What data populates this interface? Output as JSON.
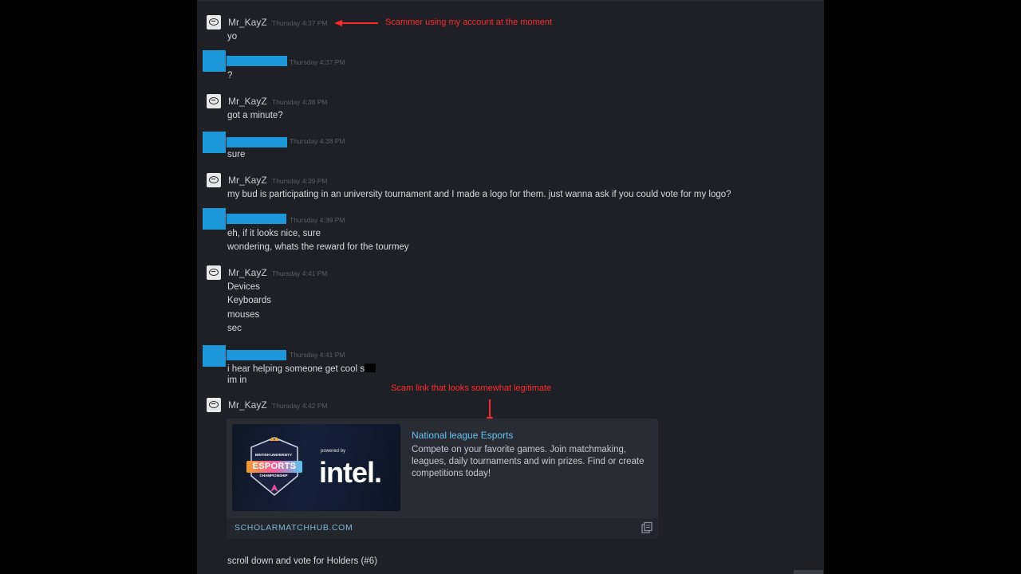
{
  "annotations": {
    "scammer_note": "Scammer using my account at the moment",
    "link_note": "Scam link that looks somewhat  legitimate",
    "color": "#ff2a2a"
  },
  "chat": {
    "messages": [
      {
        "author": "Mr_KayZ",
        "time": "Thursday 4:37 PM",
        "lines": [
          "yo"
        ]
      },
      {
        "author": "",
        "time": "Thursday 4:37 PM",
        "lines": [
          "?"
        ]
      },
      {
        "author": "Mr_KayZ",
        "time": "Thursday 4:38 PM",
        "lines": [
          "got a minute?"
        ]
      },
      {
        "author": "",
        "time": "Thursday 4:38 PM",
        "lines": [
          "sure"
        ]
      },
      {
        "author": "Mr_KayZ",
        "time": "Thursday 4:39 PM",
        "lines": [
          "my bud is participating in an university tournament and I made a logo for them. just wanna ask if you could vote for my logo?"
        ]
      },
      {
        "author": "",
        "time": "Thursday 4:39 PM",
        "lines": [
          "eh, if it looks nice, sure",
          "wondering, whats the reward for the tourmey"
        ]
      },
      {
        "author": "Mr_KayZ",
        "time": "Thursday 4:41 PM",
        "lines": [
          "Devices",
          "Keyboards",
          "mouses",
          "sec"
        ]
      },
      {
        "author": "",
        "time": "Thursday 4:41 PM",
        "lines": [
          "i hear helping someone get cool s",
          "im in"
        ]
      },
      {
        "author": "Mr_KayZ",
        "time": "Thursday 4:42 PM",
        "lines": [
          "scroll down and vote for Holders (#6)"
        ]
      }
    ],
    "embed": {
      "title": "National league Esports",
      "description": "Compete on your favorite games. Join matchmaking, leagues, daily tournaments and win prizes. Find or create competitions today!",
      "domain": "SCHOLARMATCHHUB.COM",
      "image": {
        "badge_top": "BRITISH UNIVERSITY",
        "badge_main": "ESPORTS",
        "badge_bottom": "CHAMPIONSHIP",
        "powered_by": "powered by",
        "brand": "intel."
      }
    }
  },
  "colors": {
    "panel": "#1e2026",
    "redacted_name": "#1c97d9",
    "link": "#66c0f4"
  }
}
